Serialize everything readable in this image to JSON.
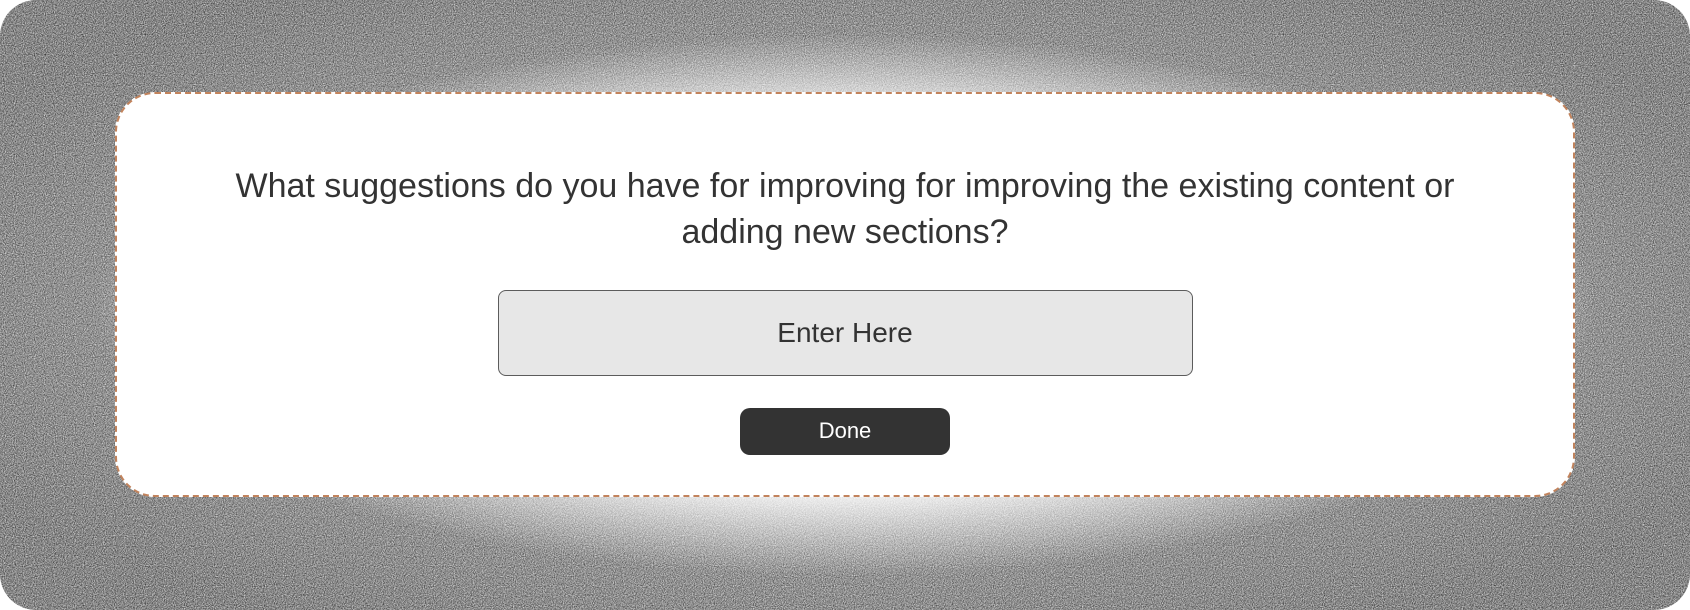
{
  "dialog": {
    "question": "What suggestions do you have for improving for improving the existing content or adding new sections?",
    "input_placeholder": "Enter Here",
    "input_value": "",
    "done_label": "Done"
  },
  "colors": {
    "card_border": "#c2835c",
    "button_bg": "#333333",
    "button_fg": "#ffffff",
    "input_bg": "#e7e7e7",
    "text": "#333333"
  }
}
